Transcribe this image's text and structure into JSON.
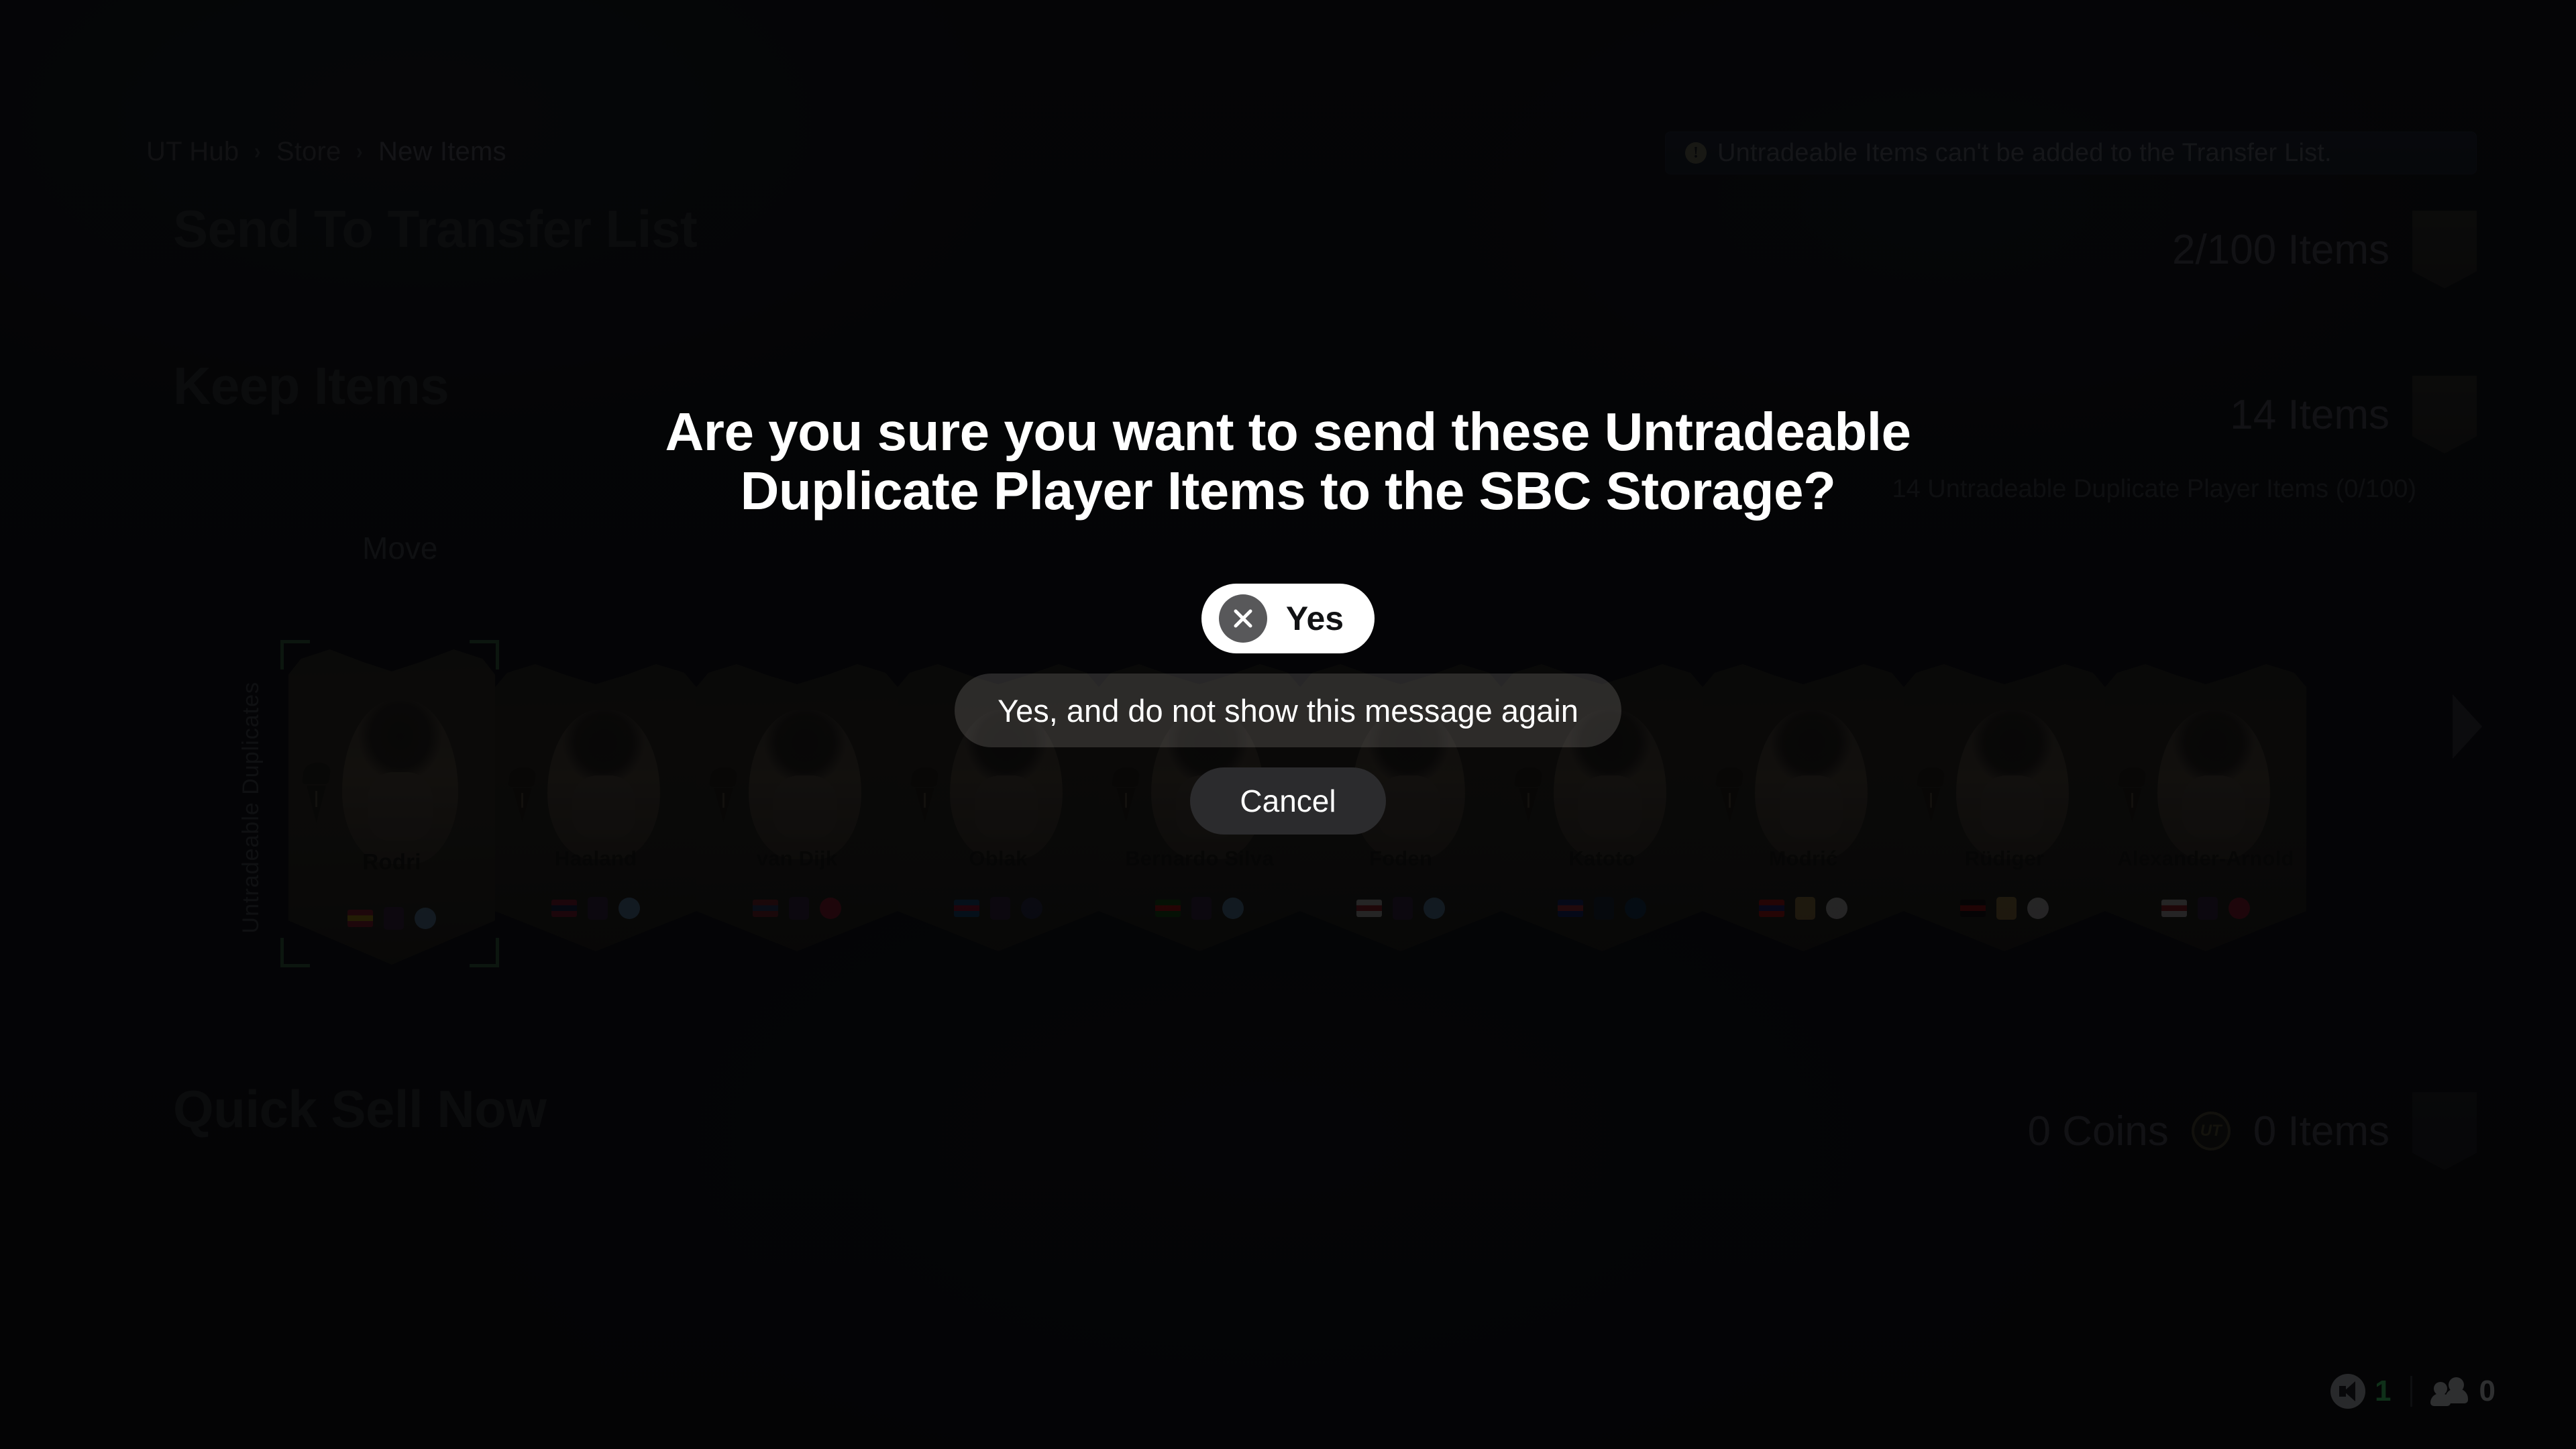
{
  "breadcrumb": {
    "items": [
      "UT Hub",
      "Store",
      "New Items"
    ],
    "separator": "›"
  },
  "notification": {
    "icon": "info-icon",
    "icon_glyph": "!",
    "text": "Untradeable Items can't be added to the Transfer List."
  },
  "sections": {
    "transfer_list": {
      "title": "Send To Transfer List",
      "count": "2/100 Items"
    },
    "keep_items": {
      "title": "Keep Items",
      "count": "14 Items",
      "subtitle": "14 Untradeable Duplicate Player Items (0/100)",
      "move_label": "Move",
      "strip_label": "Untradeable Duplicates"
    },
    "quick_sell": {
      "title": "Quick Sell Now",
      "coins": "0  Coins",
      "coin_icon": "ut-coin-icon",
      "coin_text": "UT",
      "items": "0 Items"
    }
  },
  "players": [
    {
      "name": "Rodri",
      "selected": true,
      "flag": "#c8102e",
      "flag2": "#f1bf00",
      "league": "#3d1a4f",
      "club": "#6caddf"
    },
    {
      "name": "Haaland",
      "selected": false,
      "flag": "#ba0c2f",
      "flag2": "#00205b",
      "league": "#3d1a4f",
      "club": "#6caddf"
    },
    {
      "name": "van Dijk",
      "selected": false,
      "flag": "#ae1c28",
      "flag2": "#21468b",
      "league": "#3d1a4f",
      "club": "#c8102e"
    },
    {
      "name": "Oblak",
      "selected": false,
      "flag": "#005da4",
      "flag2": "#d50032",
      "league": "#3d1a4f",
      "club": "#272e61"
    },
    {
      "name": "Bernardo Silva",
      "selected": false,
      "flag": "#006600",
      "flag2": "#ff0000",
      "league": "#3d1a4f",
      "club": "#6caddf"
    },
    {
      "name": "Foden",
      "selected": false,
      "flag": "#ffffff",
      "flag2": "#ce1124",
      "league": "#3d1a4f",
      "club": "#6caddf"
    },
    {
      "name": "Katoto",
      "selected": false,
      "flag": "#002395",
      "flag2": "#ed2939",
      "league": "#0b2240",
      "club": "#004170"
    },
    {
      "name": "Modrić",
      "selected": false,
      "flag": "#ff0000",
      "flag2": "#171796",
      "league": "#c8a04a",
      "club": "#ffffff"
    },
    {
      "name": "Rüdiger",
      "selected": false,
      "flag": "#000000",
      "flag2": "#dd0000",
      "league": "#c8a04a",
      "club": "#ffffff"
    },
    {
      "name": "Alexander-Arnold",
      "selected": false,
      "flag": "#ffffff",
      "flag2": "#ce1124",
      "league": "#3d1a4f",
      "club": "#c8102e"
    }
  ],
  "scroll": {
    "right_arrow": "chevron-right-icon"
  },
  "dialog": {
    "title": "Are you sure you want to send these Untradeable Duplicate Player Items to the SBC Storage?",
    "yes_label": "Yes",
    "yes_button_glyph": "x-button-icon",
    "dont_show_label": "Yes, and do not show this message again",
    "cancel_label": "Cancel"
  },
  "status_bar": {
    "volume_icon": "speaker-icon",
    "volume_value": "1",
    "friends_icon": "people-icon",
    "friends_value": "0"
  },
  "colors": {
    "accent_green": "#3ee06a",
    "selection_green": "#2f5e39",
    "dialog_bg": "rgba(4,4,5,0.80)",
    "card_gold": "#35301f"
  }
}
